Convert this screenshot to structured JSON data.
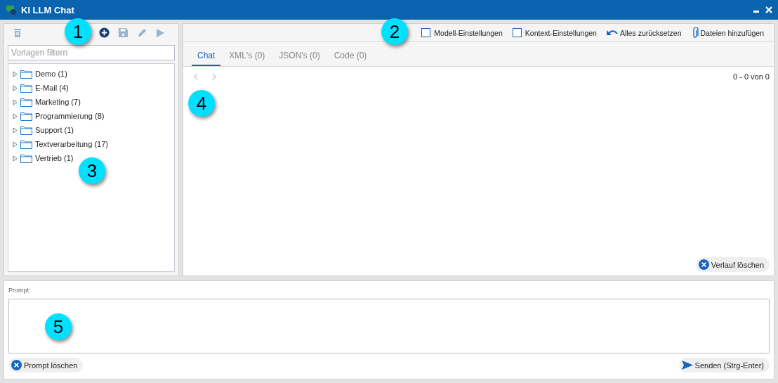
{
  "window": {
    "title": "KI LLM Chat"
  },
  "left_toolbar": [
    {
      "kind": "trash",
      "disabled": true
    },
    {
      "kind": "add",
      "disabled": false
    },
    {
      "kind": "save",
      "disabled": true
    },
    {
      "kind": "edit",
      "disabled": true
    },
    {
      "kind": "run",
      "disabled": true
    }
  ],
  "filter": {
    "placeholder": "Vorlagen filtern"
  },
  "tree": [
    {
      "label": "Demo (1)",
      "expanded": false
    },
    {
      "label": "E-Mail (4)",
      "expanded": false
    },
    {
      "label": "Marketing (7)",
      "expanded": false
    },
    {
      "label": "Programmierung (8)",
      "expanded": false
    },
    {
      "label": "Support (1)",
      "expanded": false
    },
    {
      "label": "Textverarbeitung (17)",
      "expanded": false
    },
    {
      "label": "Vertrieb (1)",
      "expanded": false
    }
  ],
  "right_toolbar": [
    {
      "kind": "checkbox",
      "label": "Modell-Einstellungen",
      "checked": false
    },
    {
      "kind": "checkbox",
      "label": "Kontext-Einstellungen",
      "checked": false
    },
    {
      "kind": "reset",
      "label": "Alles zurücksetzen"
    },
    {
      "kind": "attach",
      "label": "Dateien hinzufügen"
    }
  ],
  "tabs": [
    {
      "label": "Chat",
      "selected": true
    },
    {
      "label": "XML's (0)",
      "selected": false
    },
    {
      "label": "JSON's (0)",
      "selected": false
    },
    {
      "label": "Code (0)",
      "selected": false
    }
  ],
  "pager": {
    "prev_disabled": true,
    "next_disabled": true,
    "range": "0 - 0 von 0"
  },
  "clear_history": "Verlauf löschen",
  "prompt": {
    "label": "Prompt:",
    "clear": "Prompt löschen",
    "send": "Senden (Strg-Enter)"
  },
  "callouts": [
    "1",
    "2",
    "3",
    "4",
    "5"
  ]
}
